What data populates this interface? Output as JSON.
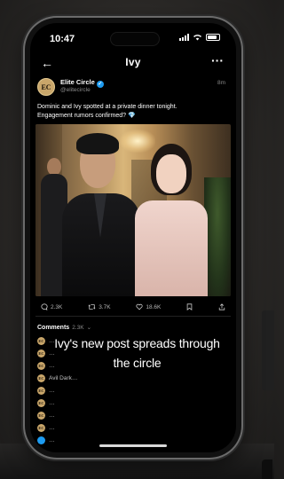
{
  "status": {
    "time": "10:47"
  },
  "nav": {
    "title": "Ivy",
    "back_icon": "arrow-left-icon",
    "more_icon": "more-horizontal-icon"
  },
  "post": {
    "author": "Elite Circle",
    "avatar_initials": "EC",
    "handle": "@elitecircle",
    "age": "8m",
    "text_line1": "Dominic and Ivy spotted at a private dinner tonight.",
    "text_line2": "Engagement rumors confirmed?",
    "emoji": "💎"
  },
  "actions": [
    {
      "icon": "comment-icon",
      "count": "2.3K"
    },
    {
      "icon": "repost-icon",
      "count": "3.7K"
    },
    {
      "icon": "heart-icon",
      "count": "18.6K"
    },
    {
      "icon": "bookmark-icon",
      "count": ""
    },
    {
      "icon": "share-icon",
      "count": ""
    }
  ],
  "comments": {
    "label": "Comments",
    "count": "2.3K",
    "items": [
      {
        "avatar": "EC",
        "text": "…"
      },
      {
        "avatar": "EC",
        "text": "…"
      },
      {
        "avatar": "EC",
        "text": "…"
      },
      {
        "avatar": "EC",
        "text": "Avil Dark…"
      },
      {
        "avatar": "EC",
        "text": "…"
      },
      {
        "avatar": "EC",
        "text": "…"
      },
      {
        "avatar": "EC",
        "text": "…"
      },
      {
        "avatar": "EC",
        "text": "…"
      },
      {
        "avatar": "",
        "text": "…"
      }
    ]
  },
  "caption": {
    "line1": "Ivy's new post spreads through",
    "line2": "the circle"
  }
}
